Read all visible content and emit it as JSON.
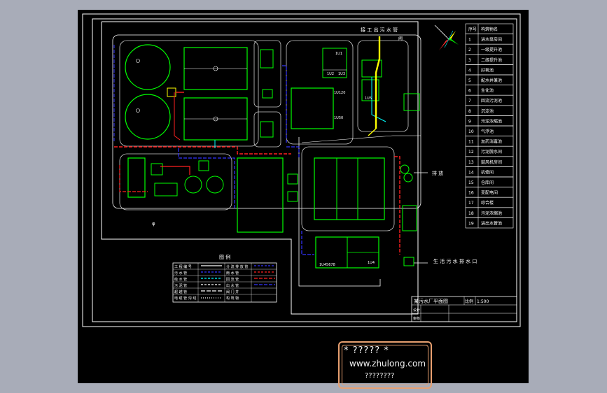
{
  "drawing": {
    "top_label": "接 工 出 污 水 管",
    "compass_label": "N",
    "outlet_label": "排 放",
    "discharge_label": "生 活 污 水 排 水 口",
    "pipe_mark": "φ",
    "top_tag": "阀",
    "building_tags": {
      "roof_A": "1U1",
      "sub_B": "1U2",
      "sub_C": "1U3",
      "tag_D": "1U120",
      "tag_E": "1U50",
      "tag_F": "1U45678",
      "tag_G": "1U4",
      "tag_H": "1U5"
    }
  },
  "legend_table": {
    "title": "图 例",
    "rows": [
      [
        "工 程 编 号",
        "",
        "分 流 排 放 管",
        ""
      ],
      [
        "污 水 管",
        "",
        "雨 水 管",
        ""
      ],
      [
        "给 水 管",
        "",
        "回 流 管",
        ""
      ],
      [
        "污 泥 管",
        "",
        "出 水 管",
        ""
      ],
      [
        "超 越 管",
        "",
        "阀 门 井",
        ""
      ],
      [
        "电 缆 管 沟 线",
        "",
        "构 筑 物",
        ""
      ]
    ]
  },
  "item_list": {
    "header": [
      "序号",
      "构筑物名"
    ],
    "rows": [
      [
        "1",
        "进水泵房间"
      ],
      [
        "2",
        "一级提升池"
      ],
      [
        "3",
        "二级提升池"
      ],
      [
        "4",
        "好氧池"
      ],
      [
        "5",
        "配水井兼池"
      ],
      [
        "6",
        "生化池"
      ],
      [
        "7",
        "回流污泥池"
      ],
      [
        "8",
        "沉淀池"
      ],
      [
        "9",
        "污泥浓缩池"
      ],
      [
        "10",
        "气浮池"
      ],
      [
        "11",
        "加药消毒池"
      ],
      [
        "12",
        "污泥脱水间"
      ],
      [
        "13",
        "鼓风机房间"
      ],
      [
        "14",
        "机修间"
      ],
      [
        "15",
        "仓库间"
      ],
      [
        "16",
        "变配电间"
      ],
      [
        "17",
        "综合楼"
      ],
      [
        "18",
        "污泥浓缩池"
      ],
      [
        "19",
        "进出水管池"
      ]
    ]
  },
  "title_block": {
    "drawing_name": "某污水厂平面图",
    "scale_label": "比例",
    "scale_value": "1:500",
    "designer_label": "设计",
    "checker_label": "审核"
  },
  "watermark": {
    "stars_text": "* ????? *",
    "site": "www.zhulong.com",
    "desc": "????????"
  },
  "colors": {
    "background": "#000000",
    "frame": "#ffffff",
    "structure": "#00ff00",
    "sewage_pipe": "#ff2020",
    "water_pipe": "#2020ff",
    "sludge_pipe": "#00ffff",
    "highlight_pipe": "#ffff00",
    "page_background": "#a8acb8"
  }
}
